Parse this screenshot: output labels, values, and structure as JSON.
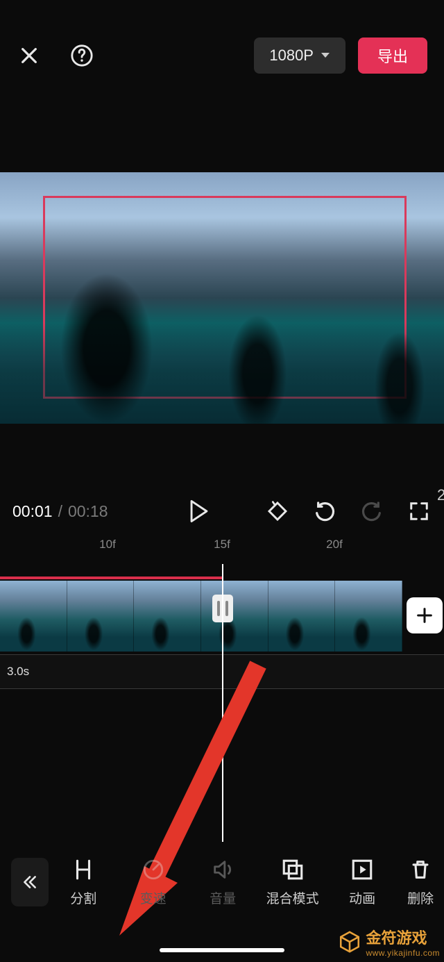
{
  "header": {
    "resolution_label": "1080P",
    "export_label": "导出"
  },
  "transport": {
    "current_time": "00:01",
    "duration": "00:18"
  },
  "ruler": {
    "ticks": [
      "10f",
      "15f",
      "20f"
    ]
  },
  "timeline": {
    "track2_duration_label": "3.0s"
  },
  "toolbar": {
    "items": [
      {
        "id": "split",
        "label": "分割",
        "dim": false
      },
      {
        "id": "speed",
        "label": "变速",
        "dim": true
      },
      {
        "id": "volume",
        "label": "音量",
        "dim": true
      },
      {
        "id": "blend",
        "label": "混合模式",
        "dim": false
      },
      {
        "id": "anim",
        "label": "动画",
        "dim": false
      },
      {
        "id": "delete",
        "label": "删除",
        "dim": false
      }
    ]
  },
  "watermark": {
    "title": "金符游戏",
    "subtitle": "www.yikajinfu.com"
  },
  "right_edge_num": "2"
}
